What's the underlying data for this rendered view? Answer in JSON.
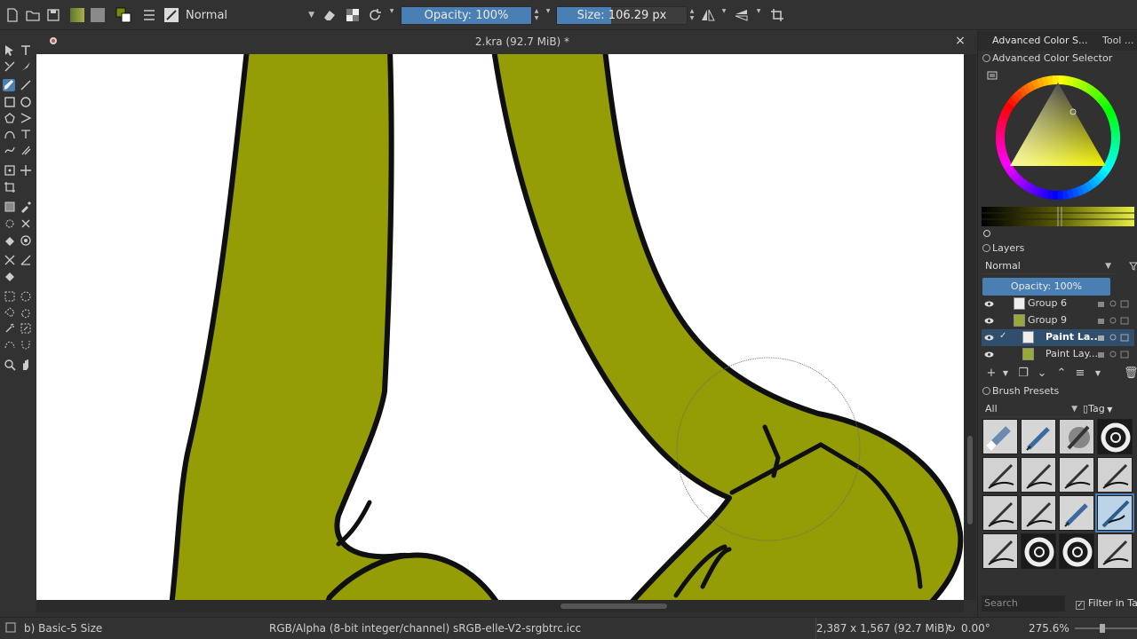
{
  "toolbar": {
    "blend_mode": "Normal",
    "opacity_label": "Opacity: 100%",
    "opacity_fraction": 1.0,
    "size_label": "Size: 106.29 px",
    "size_fraction": 0.42,
    "icons": [
      "new-document-icon",
      "open-icon",
      "save-icon",
      "gradient-icon",
      "pattern-icon",
      "color-swap-icon",
      "brush-settings-icon",
      "brush-preset-icon",
      "eraser-icon",
      "alpha-lock-icon",
      "reload-icon",
      "mirror-horizontal-icon",
      "mirror-vertical-icon",
      "wrap-icon"
    ]
  },
  "document": {
    "title": "2.kra (92.7 MiB) *",
    "close_label": "×",
    "fill_color": "#949c06",
    "outline_color": "#0f0f0f"
  },
  "dock": {
    "tabs": [
      "Advanced Color S...",
      "Tool ..."
    ],
    "color_selector_title": "Advanced Color Selector",
    "layers_title": "Layers",
    "layers_blend": "Normal",
    "layers_opacity": "Opacity: 100%",
    "layers": [
      {
        "name": "Group 6",
        "selected": false
      },
      {
        "name": "Group 9",
        "selected": false
      },
      {
        "name": "Paint La...",
        "selected": true
      },
      {
        "name": "Paint Lay...",
        "selected": false
      }
    ],
    "brush_presets_title": "Brush Presets",
    "preset_filter": "All",
    "preset_tag": "Tag",
    "search_placeholder": "Search",
    "filter_in_tag": "Filter in Tag"
  },
  "status": {
    "brush": "b) Basic-5 Size",
    "color_space": "RGB/Alpha (8-bit integer/channel)  sRGB-elle-V2-srgbtrc.icc",
    "dimensions": "2,387 x 1,567 (92.7 MiB)",
    "rotation": "0.00°",
    "zoom": "275.6%"
  }
}
